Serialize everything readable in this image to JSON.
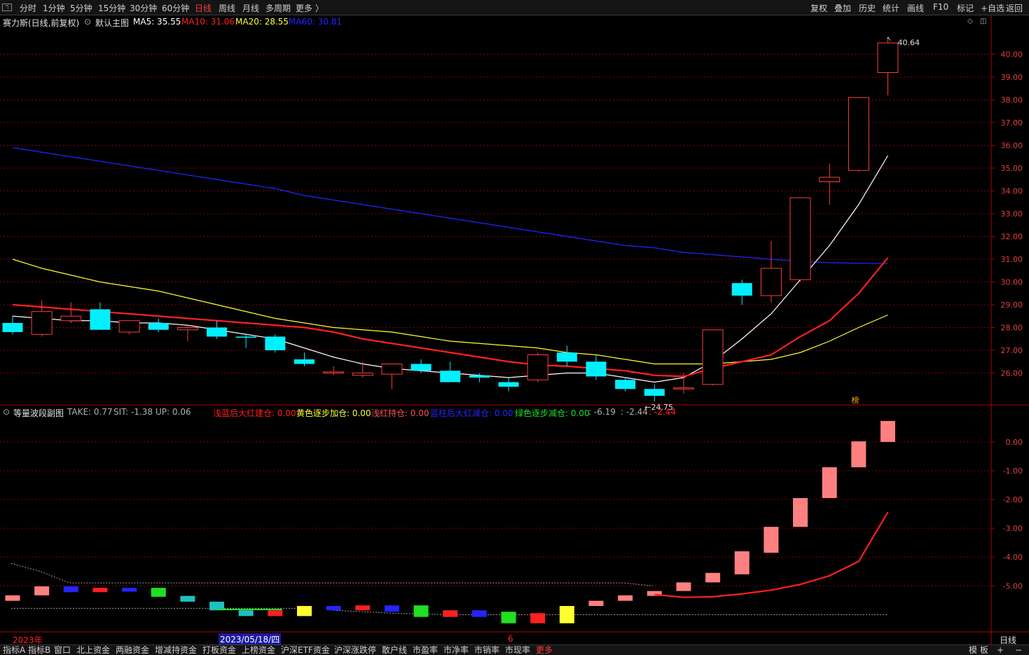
{
  "toolbar": {
    "icon_glyph": "ℸ",
    "tabs": [
      "分时",
      "1分钟",
      "5分钟",
      "15分钟",
      "30分钟",
      "60分钟",
      "日线",
      "周线",
      "月线",
      "多周期",
      "更多 〉"
    ],
    "active_tab": "日线",
    "right_buttons": [
      "复权",
      "叠加",
      "历史",
      "统计",
      "画线",
      "F10",
      "标记",
      "+自选",
      "返回"
    ]
  },
  "main_panel": {
    "stock_title": "赛力斯(日线,前复权)",
    "indicator_name": "默认主图",
    "ma": [
      {
        "label": "MA5: 35.55",
        "color": "#ffffff"
      },
      {
        "label": "MA10: 31.06",
        "color": "#ff2020"
      },
      {
        "label": "MA20: 28.55",
        "color": "#ffff30"
      },
      {
        "label": "MA60: 30.81",
        "color": "#2424ff"
      }
    ],
    "high_label": "40.64",
    "low_label": "24.75",
    "marker_char": "榜",
    "corner_icons": [
      "◇",
      "◫"
    ]
  },
  "sub_panel": {
    "name": "等量波段副图",
    "params": [
      {
        "label": "TAKE: 0.77",
        "color": "#c0c0c0"
      },
      {
        "label": "SIT: -1.38",
        "color": "#c0c0c0"
      },
      {
        "label": "UP: 0.06",
        "color": "#c0c0c0"
      },
      {
        "label": "浅蓝后大红建仓: 0.00",
        "color": "#ff2020"
      },
      {
        "label": "黄色逐步加仓: 0.00",
        "color": "#ffff30"
      },
      {
        "label": "浅红持仓: 0.00",
        "color": "#ff5050"
      },
      {
        "label": "蓝柱后大红减仓: 0.00",
        "color": "#2424ff"
      },
      {
        "label": "绿色逐步减仓: 0.00",
        "color": "#20e020"
      },
      {
        "label": ": -6.19",
        "color": "#c0c0c0"
      },
      {
        "label": ": -2.44",
        "color": "#c0c0c0"
      },
      {
        "label": ": -2.44",
        "color": "#ff2020"
      }
    ]
  },
  "date_axis": {
    "year_label": "2023年",
    "cursor_date": "2023/05/18/四",
    "month_mark": "6",
    "period_label": "日线"
  },
  "bottom_bar": {
    "tabs": [
      "指标A",
      "指标B",
      "窗口",
      "北上资金",
      "两融资金",
      "增减持资金",
      "打板资金",
      "上榜资金",
      "沪深ETF资金",
      "沪深涨跌停",
      "散户线",
      "市盈率",
      "市净率",
      "市销率",
      "市现率",
      "更多"
    ],
    "right": [
      "模 板",
      "+",
      "−"
    ]
  },
  "colors": {
    "up": "#ff3c3c",
    "down": "#00f0ff",
    "ma5": "#ffffff",
    "ma10": "#ff2020",
    "ma20": "#ffff30",
    "ma60": "#2424ff",
    "grid": "#8a0000",
    "axis": "#b00000",
    "pink": "#ff8080"
  },
  "chart_data": [
    {
      "type": "candlestick",
      "title": "赛力斯(日线,前复权)",
      "ylim": [
        25.0,
        41.0
      ],
      "yticks": [
        "26.00",
        "27.00",
        "28.00",
        "29.00",
        "30.00",
        "31.00",
        "32.00",
        "33.00",
        "34.00",
        "35.00",
        "36.00",
        "37.00",
        "38.00",
        "39.00",
        "40.00"
      ],
      "ohlc": [
        {
          "o": 28.2,
          "h": 28.5,
          "l": 27.7,
          "c": 27.8
        },
        {
          "o": 27.7,
          "h": 29.2,
          "l": 27.6,
          "c": 28.7
        },
        {
          "o": 28.3,
          "h": 29.1,
          "l": 28.2,
          "c": 28.5
        },
        {
          "o": 28.8,
          "h": 29.1,
          "l": 27.9,
          "c": 27.9
        },
        {
          "o": 27.8,
          "h": 28.3,
          "l": 27.7,
          "c": 28.3
        },
        {
          "o": 28.2,
          "h": 28.4,
          "l": 27.8,
          "c": 27.9
        },
        {
          "o": 27.9,
          "h": 28.1,
          "l": 27.4,
          "c": 28.0
        },
        {
          "o": 28.0,
          "h": 28.3,
          "l": 27.5,
          "c": 27.6
        },
        {
          "o": 27.6,
          "h": 27.7,
          "l": 27.1,
          "c": 27.55
        },
        {
          "o": 27.6,
          "h": 27.7,
          "l": 26.9,
          "c": 27.0
        },
        {
          "o": 26.6,
          "h": 26.9,
          "l": 26.3,
          "c": 26.4
        },
        {
          "o": 26.0,
          "h": 26.3,
          "l": 25.9,
          "c": 26.05
        },
        {
          "o": 25.9,
          "h": 26.5,
          "l": 25.8,
          "c": 26.0
        },
        {
          "o": 25.95,
          "h": 26.4,
          "l": 25.3,
          "c": 26.4
        },
        {
          "o": 26.4,
          "h": 26.6,
          "l": 26.0,
          "c": 26.1
        },
        {
          "o": 26.1,
          "h": 26.5,
          "l": 25.6,
          "c": 25.6
        },
        {
          "o": 25.9,
          "h": 26.0,
          "l": 25.6,
          "c": 25.8
        },
        {
          "o": 25.6,
          "h": 25.8,
          "l": 25.2,
          "c": 25.4
        },
        {
          "o": 25.7,
          "h": 26.9,
          "l": 25.6,
          "c": 26.8
        },
        {
          "o": 26.9,
          "h": 27.2,
          "l": 26.3,
          "c": 26.5
        },
        {
          "o": 26.5,
          "h": 26.8,
          "l": 25.7,
          "c": 25.85
        },
        {
          "o": 25.7,
          "h": 25.8,
          "l": 25.2,
          "c": 25.3
        },
        {
          "o": 25.3,
          "h": 25.5,
          "l": 24.75,
          "c": 25.0
        },
        {
          "o": 25.3,
          "h": 26.0,
          "l": 25.1,
          "c": 25.35
        },
        {
          "o": 25.5,
          "h": 27.9,
          "l": 25.45,
          "c": 27.9
        },
        {
          "o": 29.95,
          "h": 30.1,
          "l": 29.0,
          "c": 29.4
        },
        {
          "o": 29.4,
          "h": 31.8,
          "l": 29.1,
          "c": 30.6
        },
        {
          "o": 30.1,
          "h": 31.2,
          "l": 30.0,
          "c": 33.7
        },
        {
          "o": 34.4,
          "h": 35.2,
          "l": 33.4,
          "c": 34.6
        },
        {
          "o": 34.9,
          "h": 38.1,
          "l": 34.85,
          "c": 38.1
        },
        {
          "o": 39.2,
          "h": 40.64,
          "l": 38.2,
          "c": 40.5
        }
      ],
      "ma5": [
        28.5,
        28.4,
        28.3,
        28.3,
        28.2,
        28.2,
        28.1,
        27.9,
        27.7,
        27.5,
        27.1,
        26.7,
        26.4,
        26.2,
        26.1,
        26.0,
        25.9,
        25.8,
        25.9,
        26.0,
        26.0,
        25.8,
        25.6,
        25.8,
        26.5,
        27.5,
        28.6,
        30.1,
        31.6,
        33.4,
        35.55
      ],
      "ma10": [
        29.0,
        28.9,
        28.8,
        28.7,
        28.6,
        28.5,
        28.4,
        28.3,
        28.2,
        28.1,
        28.0,
        27.8,
        27.5,
        27.3,
        27.1,
        26.9,
        26.7,
        26.5,
        26.35,
        26.3,
        26.2,
        26.1,
        25.9,
        25.85,
        26.2,
        26.5,
        26.8,
        27.6,
        28.3,
        29.5,
        31.06
      ],
      "ma20": [
        31.0,
        30.6,
        30.3,
        30.0,
        29.8,
        29.6,
        29.3,
        29.0,
        28.7,
        28.4,
        28.2,
        28.0,
        27.9,
        27.8,
        27.6,
        27.4,
        27.3,
        27.2,
        27.1,
        26.9,
        26.8,
        26.6,
        26.4,
        26.4,
        26.4,
        26.5,
        26.6,
        26.9,
        27.4,
        28.0,
        28.55
      ],
      "ma60": [
        35.9,
        35.7,
        35.5,
        35.3,
        35.1,
        34.9,
        34.7,
        34.5,
        34.3,
        34.1,
        33.8,
        33.6,
        33.4,
        33.2,
        33.0,
        32.8,
        32.6,
        32.4,
        32.2,
        32.0,
        31.8,
        31.6,
        31.5,
        31.3,
        31.2,
        31.1,
        31.0,
        30.9,
        30.85,
        30.82,
        30.81
      ]
    },
    {
      "type": "bar",
      "title": "等量波段副图",
      "ylim": [
        -6.6,
        0.8
      ],
      "yticks": [
        "0.00",
        "-1.00",
        "-2.00",
        "-3.00",
        "-4.00",
        "-5.00"
      ],
      "bars": [
        {
          "top": -5.33,
          "bottom": -5.52,
          "color": "#ff8080"
        },
        {
          "top": -5.02,
          "bottom": -5.33,
          "color": "#ff8080"
        },
        {
          "top": -5.02,
          "bottom": -5.22,
          "color": "#2424ff"
        },
        {
          "top": -5.07,
          "bottom": -5.22,
          "color": "#ff2020"
        },
        {
          "top": -5.07,
          "bottom": -5.2,
          "color": "#2424ff"
        },
        {
          "top": -5.07,
          "bottom": -5.38,
          "color": "#20e020"
        },
        {
          "top": -5.35,
          "bottom": -5.55,
          "color": "#20c0c0"
        },
        {
          "top": -5.55,
          "bottom": -5.85,
          "color": "#20c0c0"
        },
        {
          "top": -5.85,
          "bottom": -6.05,
          "color": "#20c0c0"
        },
        {
          "top": -5.85,
          "bottom": -6.05,
          "color": "#ff2020"
        },
        {
          "top": -5.7,
          "bottom": -6.05,
          "color": "#ffff30"
        },
        {
          "top": -5.7,
          "bottom": -5.85,
          "color": "#2424ff"
        },
        {
          "top": -5.68,
          "bottom": -5.85,
          "color": "#ff2020"
        },
        {
          "top": -5.68,
          "bottom": -5.9,
          "color": "#2424ff"
        },
        {
          "top": -5.68,
          "bottom": -6.08,
          "color": "#20e020"
        },
        {
          "top": -5.85,
          "bottom": -6.08,
          "color": "#ff2020"
        },
        {
          "top": -5.85,
          "bottom": -6.08,
          "color": "#2424ff"
        },
        {
          "top": -5.9,
          "bottom": -6.3,
          "color": "#20e020"
        },
        {
          "top": -5.95,
          "bottom": -6.3,
          "color": "#ff2020"
        },
        {
          "top": -5.7,
          "bottom": -6.3,
          "color": "#ffff30"
        },
        {
          "top": -5.52,
          "bottom": -5.7,
          "color": "#ff8080"
        },
        {
          "top": -5.33,
          "bottom": -5.52,
          "color": "#ff8080"
        },
        {
          "top": -5.18,
          "bottom": -5.35,
          "color": "#ff8080"
        },
        {
          "top": -4.88,
          "bottom": -5.18,
          "color": "#ff8080"
        },
        {
          "top": -4.55,
          "bottom": -4.88,
          "color": "#ff8080"
        },
        {
          "top": -3.8,
          "bottom": -4.6,
          "color": "#ff8080"
        },
        {
          "top": -2.95,
          "bottom": -3.85,
          "color": "#ff8080"
        },
        {
          "top": -1.95,
          "bottom": -2.95,
          "color": "#ff8080"
        },
        {
          "top": -0.88,
          "bottom": -1.95,
          "color": "#ff8080"
        },
        {
          "top": 0.02,
          "bottom": -0.88,
          "color": "#ff8080"
        },
        {
          "top": 0.73,
          "bottom": 0.0,
          "color": "#ff8080"
        }
      ],
      "red_line_x": [
        22,
        23,
        24,
        25,
        26,
        27,
        28,
        29,
        30
      ],
      "red_line_y": [
        -5.3,
        -5.4,
        -5.38,
        -5.28,
        -5.15,
        -4.95,
        -4.65,
        -4.15,
        -2.44
      ],
      "dotted_upper": [
        -4.22,
        -4.5,
        -4.9,
        -4.9,
        -4.9,
        -4.9,
        -4.9,
        -4.9,
        -4.9,
        -4.9,
        -4.9,
        -4.9,
        -4.9,
        -4.9,
        -4.9,
        -4.9,
        -4.9,
        -4.9,
        -4.9,
        -4.9,
        -4.9,
        -4.9,
        -5.0
      ],
      "dotted_lower_a": [
        -5.78,
        -5.78,
        -5.78,
        -5.78,
        -5.78,
        -5.78,
        -5.78,
        -5.78,
        -5.78,
        -5.78,
        -5.78
      ],
      "dotted_lower_b": [
        -5.85,
        -5.9,
        -5.95,
        -5.98,
        -6.0,
        -6.0,
        -6.0,
        -6.0,
        -6.0,
        -6.0,
        -6.0,
        -6.0,
        -6.0,
        -6.0,
        -6.0,
        -6.0,
        -6.0,
        -6.0,
        -6.0,
        -6.0
      ]
    }
  ]
}
